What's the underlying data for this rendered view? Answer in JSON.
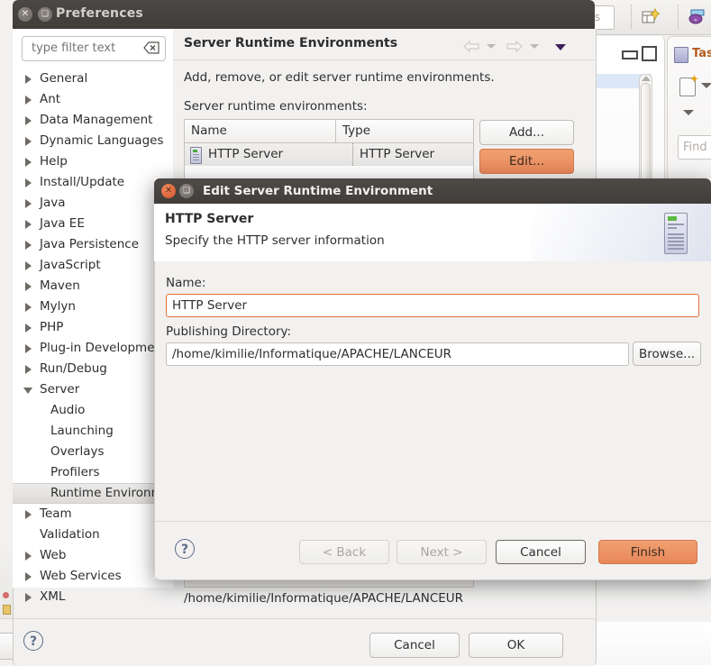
{
  "background": {
    "quick_access_text": "ccess",
    "tasks_view_title": "Tas",
    "find_placeholder": "Find"
  },
  "preferences": {
    "title": "Preferences",
    "close_icon": "close-icon",
    "maximize_icon": "maximize-icon",
    "filter": {
      "placeholder": "type filter text",
      "value": "",
      "clear_icon": "clear-icon"
    },
    "tree": [
      {
        "label": "General",
        "expandable": true,
        "expanded": false,
        "child": false,
        "selected": false
      },
      {
        "label": "Ant",
        "expandable": true,
        "expanded": false,
        "child": false,
        "selected": false
      },
      {
        "label": "Data Management",
        "expandable": true,
        "expanded": false,
        "child": false,
        "selected": false
      },
      {
        "label": "Dynamic Languages",
        "expandable": true,
        "expanded": false,
        "child": false,
        "selected": false
      },
      {
        "label": "Help",
        "expandable": true,
        "expanded": false,
        "child": false,
        "selected": false
      },
      {
        "label": "Install/Update",
        "expandable": true,
        "expanded": false,
        "child": false,
        "selected": false
      },
      {
        "label": "Java",
        "expandable": true,
        "expanded": false,
        "child": false,
        "selected": false
      },
      {
        "label": "Java EE",
        "expandable": true,
        "expanded": false,
        "child": false,
        "selected": false
      },
      {
        "label": "Java Persistence",
        "expandable": true,
        "expanded": false,
        "child": false,
        "selected": false
      },
      {
        "label": "JavaScript",
        "expandable": true,
        "expanded": false,
        "child": false,
        "selected": false
      },
      {
        "label": "Maven",
        "expandable": true,
        "expanded": false,
        "child": false,
        "selected": false
      },
      {
        "label": "Mylyn",
        "expandable": true,
        "expanded": false,
        "child": false,
        "selected": false
      },
      {
        "label": "PHP",
        "expandable": true,
        "expanded": false,
        "child": false,
        "selected": false
      },
      {
        "label": "Plug-in Development",
        "expandable": true,
        "expanded": false,
        "child": false,
        "selected": false
      },
      {
        "label": "Run/Debug",
        "expandable": true,
        "expanded": false,
        "child": false,
        "selected": false
      },
      {
        "label": "Server",
        "expandable": true,
        "expanded": true,
        "child": false,
        "selected": false
      },
      {
        "label": "Audio",
        "expandable": false,
        "expanded": false,
        "child": true,
        "selected": false
      },
      {
        "label": "Launching",
        "expandable": false,
        "expanded": false,
        "child": true,
        "selected": false
      },
      {
        "label": "Overlays",
        "expandable": false,
        "expanded": false,
        "child": true,
        "selected": false
      },
      {
        "label": "Profilers",
        "expandable": false,
        "expanded": false,
        "child": true,
        "selected": false
      },
      {
        "label": "Runtime Environme",
        "expandable": false,
        "expanded": false,
        "child": true,
        "selected": true
      },
      {
        "label": "Team",
        "expandable": true,
        "expanded": false,
        "child": false,
        "selected": false
      },
      {
        "label": "Validation",
        "expandable": false,
        "expanded": false,
        "child": false,
        "selected": false
      },
      {
        "label": "Web",
        "expandable": true,
        "expanded": false,
        "child": false,
        "selected": false
      },
      {
        "label": "Web Services",
        "expandable": true,
        "expanded": false,
        "child": false,
        "selected": false
      },
      {
        "label": "XML",
        "expandable": true,
        "expanded": false,
        "child": false,
        "selected": false
      }
    ],
    "page": {
      "title": "Server Runtime Environments",
      "description": "Add, remove, or edit server runtime environments.",
      "subtitle": "Server runtime environments:",
      "back_icon": "back-arrow-icon",
      "forward_icon": "forward-arrow-icon",
      "menu_icon": "view-menu-icon",
      "table": {
        "columns": [
          "Name",
          "Type"
        ],
        "rows": [
          {
            "name": "HTTP Server",
            "type": "HTTP Server",
            "icon": "server-icon"
          }
        ]
      },
      "buttons": {
        "add": "Add...",
        "edit": "Edit..."
      },
      "path_line": "/home/kimilie/Informatique/APACHE/LANCEUR"
    },
    "footer": {
      "help_label": "?",
      "cancel": "Cancel",
      "ok": "OK"
    }
  },
  "edit_dialog": {
    "title": "Edit Server Runtime Environment",
    "close_icon": "close-icon",
    "maximize_icon": "maximize-icon",
    "header": {
      "heading": "HTTP Server",
      "subheading": "Specify the HTTP server information",
      "icon": "server-tower-icon"
    },
    "fields": {
      "name_label": "Name:",
      "name_value": "HTTP Server",
      "publishing_label": "Publishing Directory:",
      "publishing_value": "/home/kimilie/Informatique/APACHE/LANCEUR",
      "browse_label": "Browse..."
    },
    "footer": {
      "help_label": "?",
      "back": "< Back",
      "next": "Next >",
      "cancel": "Cancel",
      "finish": "Finish"
    }
  },
  "colors": {
    "accent_orange": "#e8875a",
    "titlebar_dark": "#443f3c",
    "panel_bg": "#f2f1f0",
    "focus_border": "#e2703a"
  }
}
